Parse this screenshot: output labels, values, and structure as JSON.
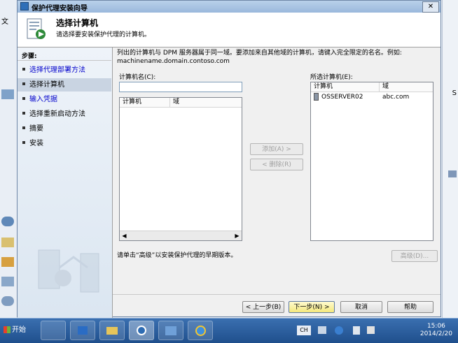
{
  "window": {
    "title": "保护代理安装向导",
    "close_label": "✕"
  },
  "header": {
    "title": "选择计算机",
    "subtitle": "请选择要安装保护代理的计算机。"
  },
  "steps": {
    "title": "步骤:",
    "items": [
      {
        "label": "选择代理部署方法",
        "state": "done"
      },
      {
        "label": "选择计算机",
        "state": "current"
      },
      {
        "label": "输入凭据",
        "state": "done"
      },
      {
        "label": "选择重新启动方法",
        "state": "pending"
      },
      {
        "label": "摘要",
        "state": "pending"
      },
      {
        "label": "安装",
        "state": "pending"
      }
    ]
  },
  "content": {
    "description": "列出的计算机与 DPM 服务器属于同一域。要添加来自其他域的计算机，请键入完全限定的名名。例如: machinename.domain.contoso.com",
    "computer_name_label": "计算机名(C):",
    "computer_name_value": "",
    "available": {
      "columns": [
        "计算机",
        "域"
      ],
      "rows": []
    },
    "selected_label": "所选计算机(E):",
    "selected": {
      "columns": [
        "计算机",
        "域"
      ],
      "rows": [
        {
          "computer": "OSSERVER02",
          "domain": "abc.com"
        }
      ]
    },
    "add_button": "添加(A) >",
    "remove_button": "< 删除(R)",
    "advanced_note": "请单击“高级”以安装保护代理的早期版本。",
    "advanced_button": "高级(D)..."
  },
  "footer": {
    "back": "< 上一步(B)",
    "next": "下一步(N) >",
    "cancel": "取消",
    "help": "帮助"
  },
  "taskbar": {
    "start": "开始",
    "lang": "CH",
    "time": "15:06",
    "date": "2014/2/20"
  },
  "background": {
    "menu_fragment": "文"
  }
}
